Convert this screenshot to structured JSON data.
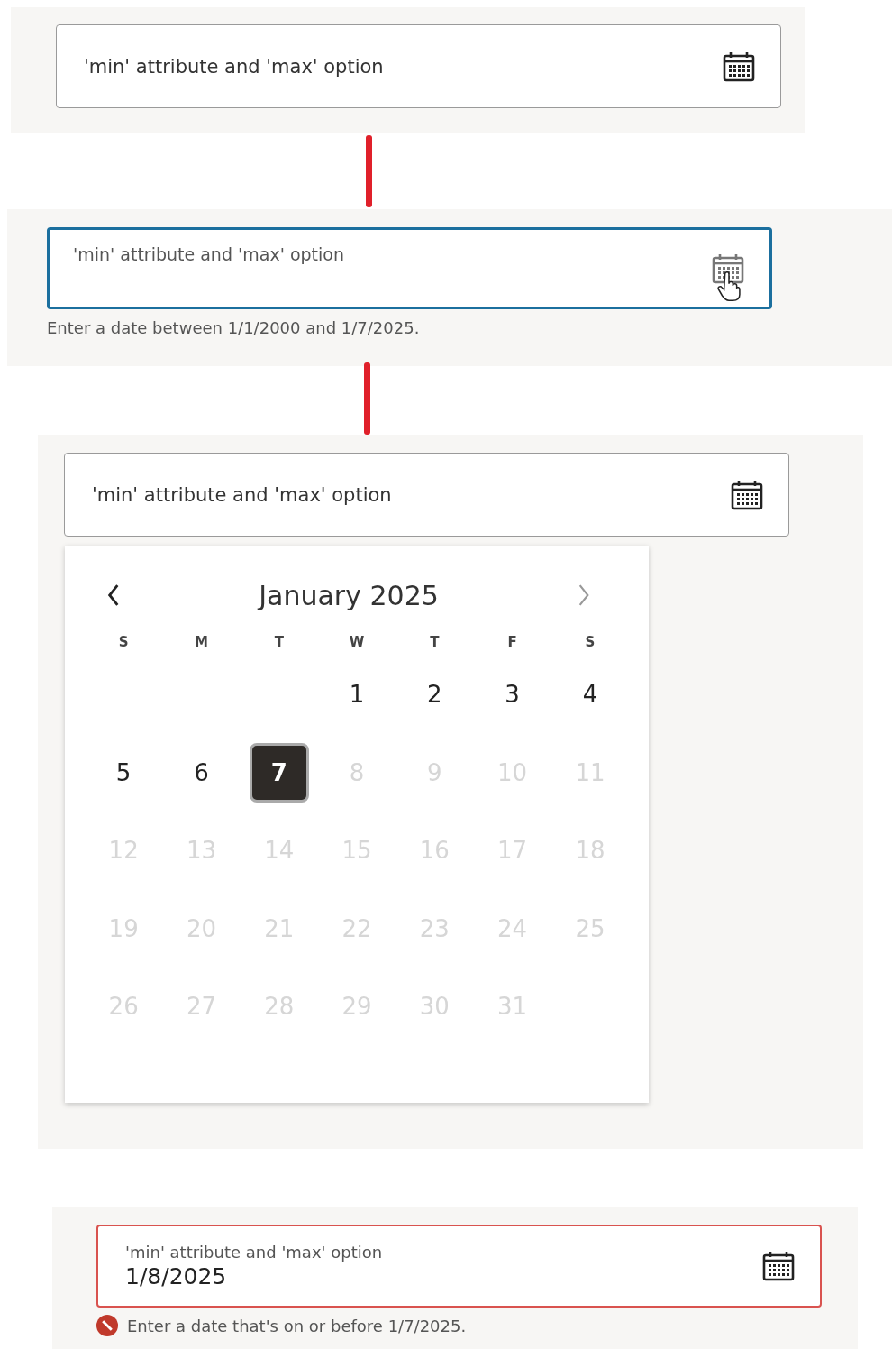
{
  "steps": [
    {
      "kind": "idle",
      "label": "'min' attribute and 'max' option"
    },
    {
      "kind": "focused",
      "label": "'min' attribute and 'max' option",
      "help": "Enter a date between 1/1/2000 and 1/7/2025."
    },
    {
      "kind": "open",
      "label": "'min' attribute and 'max' option",
      "calendar": {
        "month": "January 2025",
        "prev_disabled": false,
        "next_disabled": true,
        "weekdays": [
          "S",
          "M",
          "T",
          "W",
          "T",
          "F",
          "S"
        ],
        "weeks": [
          [
            {
              "day": "1",
              "disabled": false,
              "selected": false
            },
            {
              "day": "2",
              "disabled": false,
              "selected": false
            },
            {
              "day": "3",
              "disabled": false,
              "selected": false
            },
            {
              "day": "4",
              "disabled": false,
              "selected": false
            }
          ],
          [
            {
              "day": "5",
              "disabled": false,
              "selected": false
            },
            {
              "day": "6",
              "disabled": false,
              "selected": false
            },
            {
              "day": "7",
              "disabled": false,
              "selected": true
            },
            {
              "day": "8",
              "disabled": true,
              "selected": false
            },
            {
              "day": "9",
              "disabled": true,
              "selected": false
            },
            {
              "day": "10",
              "disabled": true,
              "selected": false
            },
            {
              "day": "11",
              "disabled": true,
              "selected": false
            }
          ],
          [
            {
              "day": "12",
              "disabled": true,
              "selected": false
            },
            {
              "day": "13",
              "disabled": true,
              "selected": false
            },
            {
              "day": "14",
              "disabled": true,
              "selected": false
            },
            {
              "day": "15",
              "disabled": true,
              "selected": false
            },
            {
              "day": "16",
              "disabled": true,
              "selected": false
            },
            {
              "day": "17",
              "disabled": true,
              "selected": false
            },
            {
              "day": "18",
              "disabled": true,
              "selected": false
            }
          ],
          [
            {
              "day": "19",
              "disabled": true,
              "selected": false
            },
            {
              "day": "20",
              "disabled": true,
              "selected": false
            },
            {
              "day": "21",
              "disabled": true,
              "selected": false
            },
            {
              "day": "22",
              "disabled": true,
              "selected": false
            },
            {
              "day": "23",
              "disabled": true,
              "selected": false
            },
            {
              "day": "24",
              "disabled": true,
              "selected": false
            },
            {
              "day": "25",
              "disabled": true,
              "selected": false
            }
          ],
          [
            {
              "day": "26",
              "disabled": true,
              "selected": false
            },
            {
              "day": "27",
              "disabled": true,
              "selected": false
            },
            {
              "day": "28",
              "disabled": true,
              "selected": false
            },
            {
              "day": "29",
              "disabled": true,
              "selected": false
            },
            {
              "day": "30",
              "disabled": true,
              "selected": false
            },
            {
              "day": "31",
              "disabled": true,
              "selected": false
            }
          ]
        ]
      }
    },
    {
      "kind": "error",
      "label": "'min' attribute and 'max' option",
      "value": "1/8/2025",
      "error": "Enter a date that's on or before 1/7/2025."
    }
  ]
}
